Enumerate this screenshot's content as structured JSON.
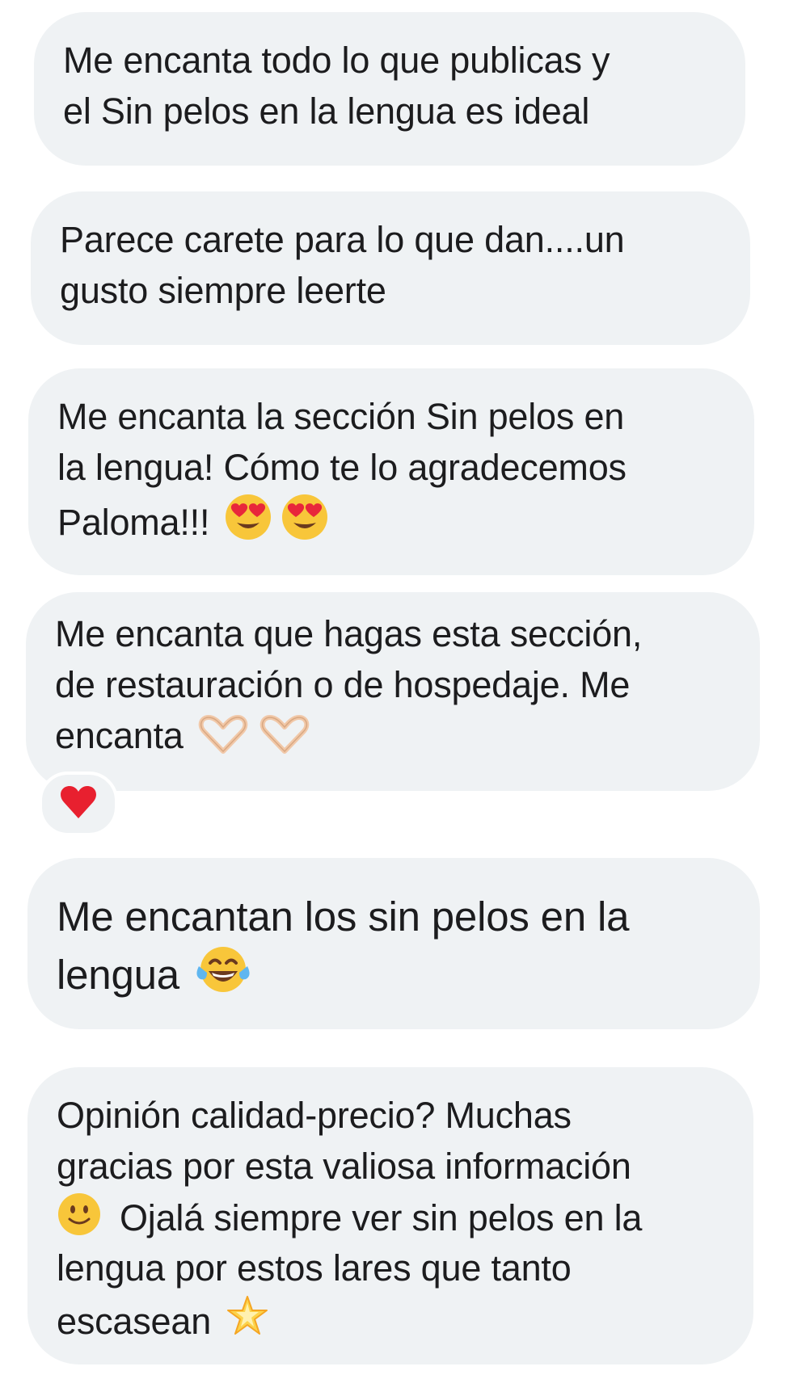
{
  "comments": [
    {
      "lines": [
        "Me encanta todo lo que publicas y",
        "el  Sin pelos en la lengua es ideal"
      ]
    },
    {
      "lines": [
        "Parece carete para lo que dan....un",
        "gusto siempre leerte"
      ]
    },
    {
      "lines": [
        "Me encanta la sección Sin pelos en",
        "la lengua! Cómo te lo agradecemos",
        "Paloma!!!"
      ],
      "emojis": [
        "heart-eyes-emoji",
        "heart-eyes-emoji"
      ]
    },
    {
      "lines": [
        "Me encanta que hagas esta sección,",
        "de restauración o de hospedaje. Me",
        "encanta"
      ],
      "emojis": [
        "heart-hands-emoji",
        "heart-hands-emoji"
      ],
      "reaction": "red-heart-emoji"
    },
    {
      "lines": [
        "Me encantan los sin pelos en la",
        "lengua"
      ],
      "emojis": [
        "tears-of-joy-emoji"
      ]
    },
    {
      "lines": [
        "Opinión calidad-precio? Muchas",
        "gracias por esta valiosa información",
        "Ojalá siempre ver sin pelos en la",
        "lengua por estos lares que tanto",
        "escasean"
      ],
      "emojis": [
        "slightly-smiling-emoji",
        "glowing-star-emoji"
      ]
    }
  ],
  "colors": {
    "bubble_bg": "#eff2f4",
    "text": "#1c1c1e",
    "page_bg": "#ffffff"
  }
}
